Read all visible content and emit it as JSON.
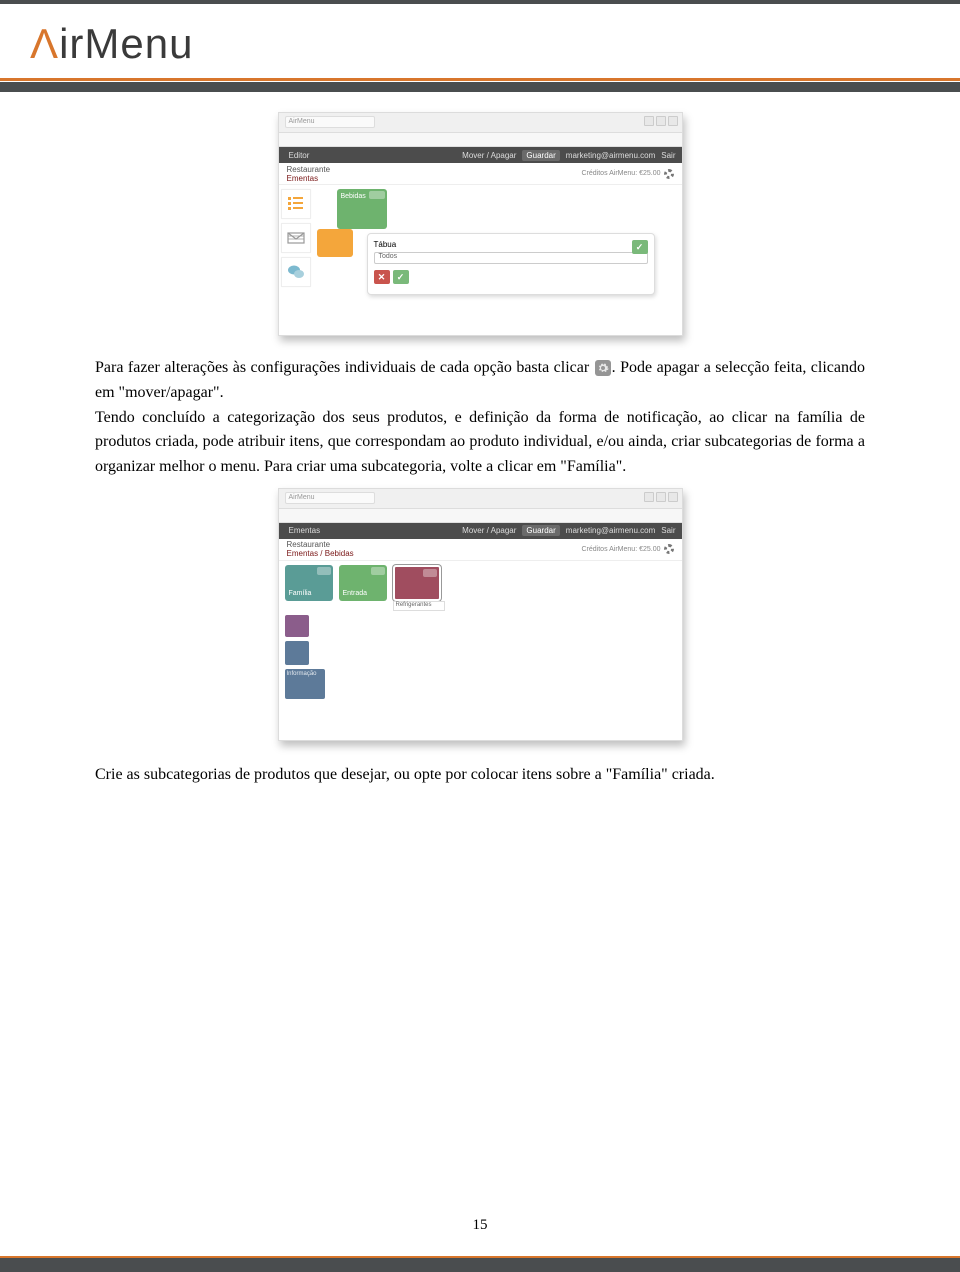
{
  "header": {
    "logo_text": "irMenu"
  },
  "screenshot1": {
    "tab_hint": "AirMenu",
    "toolbar": {
      "editar": "Editor",
      "mover": "Mover / Apagar",
      "guardar": "Guardar",
      "user": "marketing@airmenu.com",
      "sair": "Sair"
    },
    "breadcrumb_top": "Restaurante",
    "breadcrumb": "Ementas",
    "credits": "Créditos AirMenu: €25.00",
    "green_tile": "Bebidas",
    "panel_field_label": "Tábua",
    "panel_dropdown": "Todos"
  },
  "para1": {
    "t1": "Para fazer alterações às configurações individuais de cada opção basta clicar ",
    "t2": ". Pode apagar a selecção feita, clicando em \"mover/apagar\".",
    "t3": "Tendo concluído a categorização dos seus produtos, e definição da forma de notificação, ao clicar na família de produtos criada, pode atribuir itens, que correspondam ao produto individual, e/ou ainda, criar subcategorias de forma a organizar melhor o menu. Para criar uma subcategoria, volte a clicar em \"Família\"."
  },
  "screenshot2": {
    "tab_hint": "AirMenu",
    "toolbar": {
      "ementas": "Ementas",
      "mover": "Mover / Apagar",
      "guardar": "Guardar",
      "user": "marketing@airmenu.com",
      "sair": "Sair"
    },
    "breadcrumb_top": "Restaurante",
    "breadcrumb": "Ementas / Bebidas",
    "credits": "Créditos AirMenu: €25.00",
    "tiles": {
      "familia": "Família",
      "entrada": "Entrada",
      "refrigerantes": "Refrigerantes"
    },
    "side": {
      "info": "Informação"
    }
  },
  "para2": "Crie as subcategorias de produtos que desejar, ou opte por colocar itens sobre a \"Família\" criada.",
  "page_number": "15"
}
